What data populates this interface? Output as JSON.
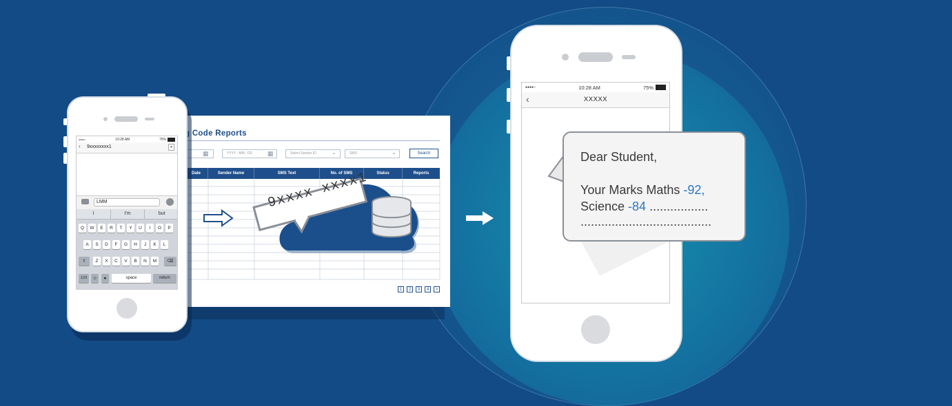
{
  "left_phone": {
    "status_signal": "●●●●○",
    "time": "10:28 AM",
    "battery": "75%",
    "back": "‹",
    "contact": "9xxxxxxxx1",
    "message_input": "LMM",
    "suggestions": [
      "I",
      "I'm",
      "but"
    ],
    "row1": [
      "Q",
      "W",
      "E",
      "R",
      "T",
      "Y",
      "U",
      "I",
      "O",
      "P"
    ],
    "row2": [
      "A",
      "S",
      "D",
      "F",
      "G",
      "H",
      "J",
      "K",
      "L"
    ],
    "row3": [
      "Z",
      "X",
      "C",
      "V",
      "B",
      "N",
      "M"
    ],
    "key_123": "123",
    "key_space": "space",
    "key_return": "return"
  },
  "report": {
    "title": "g Code Reports",
    "date_placeholder": "YYYY : MM : DD",
    "sender_placeholder": "Select Sender ID",
    "type_select": "SMS",
    "search_label": "Search",
    "columns": [
      "Date",
      "Sender Name",
      "SMS Text",
      "No. of SMS",
      "Status",
      "Reports"
    ],
    "sms_tag": "9xxxx xxxx1",
    "pages": [
      "1",
      "2",
      "3",
      "4",
      ">"
    ]
  },
  "right_phone": {
    "status_signal": "●●●●○",
    "time": "10:28 AM",
    "battery": "75%",
    "back": "‹",
    "contact": "XXXXX",
    "message": {
      "greeting": "Dear Student,",
      "line1_prefix": "Your Marks Maths ",
      "line1_value": "-92,",
      "line2_prefix": "Science ",
      "line2_value": "-84",
      "line2_suffix": " .................",
      "line3": "......................................"
    }
  },
  "colors": {
    "background": "#134b86",
    "accent_blue": "#1f4f8b",
    "highlight_blue": "#2b77c0",
    "cloud_blue": "#1b4f8c"
  }
}
